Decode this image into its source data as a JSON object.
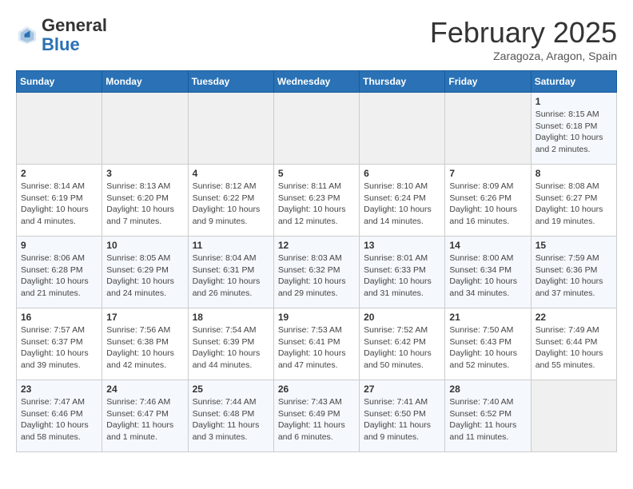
{
  "logo": {
    "general": "General",
    "blue": "Blue"
  },
  "header": {
    "month": "February 2025",
    "location": "Zaragoza, Aragon, Spain"
  },
  "days_of_week": [
    "Sunday",
    "Monday",
    "Tuesday",
    "Wednesday",
    "Thursday",
    "Friday",
    "Saturday"
  ],
  "weeks": [
    [
      {
        "day": "",
        "detail": ""
      },
      {
        "day": "",
        "detail": ""
      },
      {
        "day": "",
        "detail": ""
      },
      {
        "day": "",
        "detail": ""
      },
      {
        "day": "",
        "detail": ""
      },
      {
        "day": "",
        "detail": ""
      },
      {
        "day": "1",
        "detail": "Sunrise: 8:15 AM\nSunset: 6:18 PM\nDaylight: 10 hours\nand 2 minutes."
      }
    ],
    [
      {
        "day": "2",
        "detail": "Sunrise: 8:14 AM\nSunset: 6:19 PM\nDaylight: 10 hours\nand 4 minutes."
      },
      {
        "day": "3",
        "detail": "Sunrise: 8:13 AM\nSunset: 6:20 PM\nDaylight: 10 hours\nand 7 minutes."
      },
      {
        "day": "4",
        "detail": "Sunrise: 8:12 AM\nSunset: 6:22 PM\nDaylight: 10 hours\nand 9 minutes."
      },
      {
        "day": "5",
        "detail": "Sunrise: 8:11 AM\nSunset: 6:23 PM\nDaylight: 10 hours\nand 12 minutes."
      },
      {
        "day": "6",
        "detail": "Sunrise: 8:10 AM\nSunset: 6:24 PM\nDaylight: 10 hours\nand 14 minutes."
      },
      {
        "day": "7",
        "detail": "Sunrise: 8:09 AM\nSunset: 6:26 PM\nDaylight: 10 hours\nand 16 minutes."
      },
      {
        "day": "8",
        "detail": "Sunrise: 8:08 AM\nSunset: 6:27 PM\nDaylight: 10 hours\nand 19 minutes."
      }
    ],
    [
      {
        "day": "9",
        "detail": "Sunrise: 8:06 AM\nSunset: 6:28 PM\nDaylight: 10 hours\nand 21 minutes."
      },
      {
        "day": "10",
        "detail": "Sunrise: 8:05 AM\nSunset: 6:29 PM\nDaylight: 10 hours\nand 24 minutes."
      },
      {
        "day": "11",
        "detail": "Sunrise: 8:04 AM\nSunset: 6:31 PM\nDaylight: 10 hours\nand 26 minutes."
      },
      {
        "day": "12",
        "detail": "Sunrise: 8:03 AM\nSunset: 6:32 PM\nDaylight: 10 hours\nand 29 minutes."
      },
      {
        "day": "13",
        "detail": "Sunrise: 8:01 AM\nSunset: 6:33 PM\nDaylight: 10 hours\nand 31 minutes."
      },
      {
        "day": "14",
        "detail": "Sunrise: 8:00 AM\nSunset: 6:34 PM\nDaylight: 10 hours\nand 34 minutes."
      },
      {
        "day": "15",
        "detail": "Sunrise: 7:59 AM\nSunset: 6:36 PM\nDaylight: 10 hours\nand 37 minutes."
      }
    ],
    [
      {
        "day": "16",
        "detail": "Sunrise: 7:57 AM\nSunset: 6:37 PM\nDaylight: 10 hours\nand 39 minutes."
      },
      {
        "day": "17",
        "detail": "Sunrise: 7:56 AM\nSunset: 6:38 PM\nDaylight: 10 hours\nand 42 minutes."
      },
      {
        "day": "18",
        "detail": "Sunrise: 7:54 AM\nSunset: 6:39 PM\nDaylight: 10 hours\nand 44 minutes."
      },
      {
        "day": "19",
        "detail": "Sunrise: 7:53 AM\nSunset: 6:41 PM\nDaylight: 10 hours\nand 47 minutes."
      },
      {
        "day": "20",
        "detail": "Sunrise: 7:52 AM\nSunset: 6:42 PM\nDaylight: 10 hours\nand 50 minutes."
      },
      {
        "day": "21",
        "detail": "Sunrise: 7:50 AM\nSunset: 6:43 PM\nDaylight: 10 hours\nand 52 minutes."
      },
      {
        "day": "22",
        "detail": "Sunrise: 7:49 AM\nSunset: 6:44 PM\nDaylight: 10 hours\nand 55 minutes."
      }
    ],
    [
      {
        "day": "23",
        "detail": "Sunrise: 7:47 AM\nSunset: 6:46 PM\nDaylight: 10 hours\nand 58 minutes."
      },
      {
        "day": "24",
        "detail": "Sunrise: 7:46 AM\nSunset: 6:47 PM\nDaylight: 11 hours\nand 1 minute."
      },
      {
        "day": "25",
        "detail": "Sunrise: 7:44 AM\nSunset: 6:48 PM\nDaylight: 11 hours\nand 3 minutes."
      },
      {
        "day": "26",
        "detail": "Sunrise: 7:43 AM\nSunset: 6:49 PM\nDaylight: 11 hours\nand 6 minutes."
      },
      {
        "day": "27",
        "detail": "Sunrise: 7:41 AM\nSunset: 6:50 PM\nDaylight: 11 hours\nand 9 minutes."
      },
      {
        "day": "28",
        "detail": "Sunrise: 7:40 AM\nSunset: 6:52 PM\nDaylight: 11 hours\nand 11 minutes."
      },
      {
        "day": "",
        "detail": ""
      }
    ]
  ]
}
